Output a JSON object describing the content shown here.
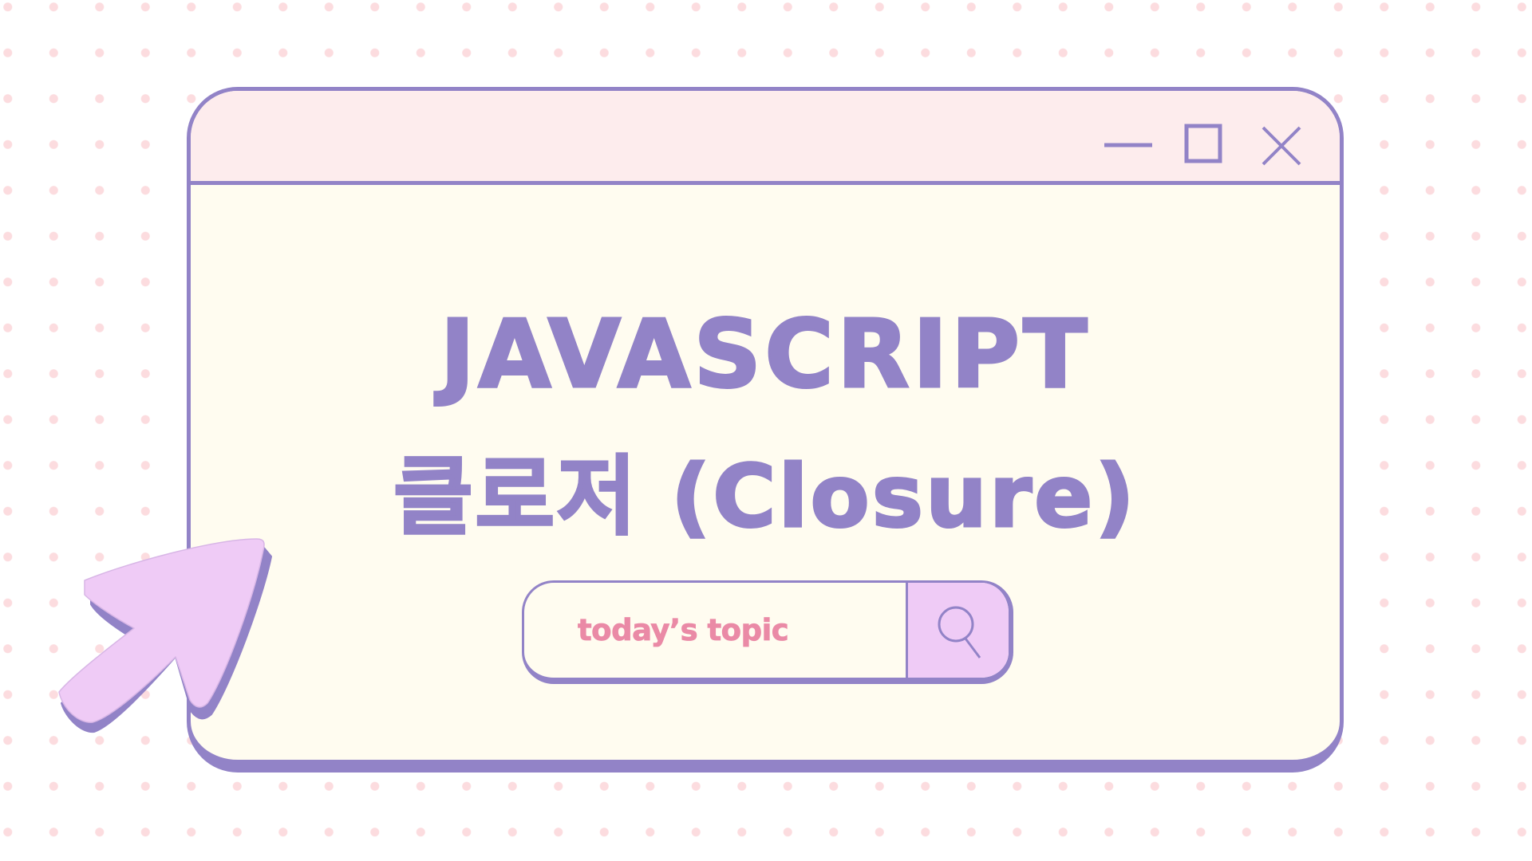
{
  "window": {
    "controls": {
      "minimize_icon": "minimize-icon",
      "maximize_icon": "maximize-icon",
      "close_icon": "close-icon"
    }
  },
  "content": {
    "title_line1": "JAVASCRIPT",
    "title_line2": "클로저 (Closure)"
  },
  "search": {
    "label": "today’s topic",
    "button_icon": "search-icon"
  },
  "decoration": {
    "cursor_icon": "pointer-arrow-icon"
  },
  "colors": {
    "accent": "#9283c7",
    "titlebar": "#fdeced",
    "window_body": "#fffcf0",
    "label_pink": "#ea8aa6",
    "lavender": "#efcbf6",
    "dots": "#fcdcdf"
  }
}
